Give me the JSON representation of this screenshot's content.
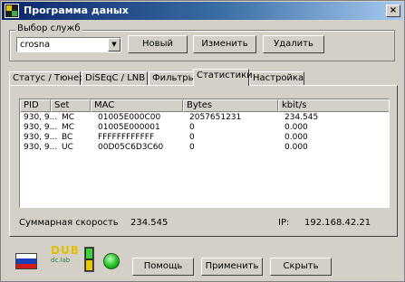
{
  "window": {
    "title": "Программа даных",
    "close_glyph": "×"
  },
  "service": {
    "group_label": "Выбор служб",
    "combo_value": "crosna",
    "buttons": {
      "new": "Новый",
      "edit": "Изменить",
      "delete": "Удалить"
    }
  },
  "tabs": [
    {
      "label": "Статус / Тюнер"
    },
    {
      "label": "DiSEqC / LNB"
    },
    {
      "label": "Фильтры"
    },
    {
      "label": "Статистики",
      "active": true
    },
    {
      "label": "Настройка"
    }
  ],
  "table": {
    "headers": [
      "PID",
      "Set",
      "MAC",
      "Bytes",
      "kbit/s"
    ],
    "rows": [
      [
        "930, 9...",
        "MC",
        "01005E000C00",
        "2057651231",
        "234.545"
      ],
      [
        "930, 9...",
        "MC",
        "01005E000001",
        "0",
        "0.000"
      ],
      [
        "930, 9...",
        "BC",
        "FFFFFFFFFFFF",
        "0",
        "0.000"
      ],
      [
        "930, 9...",
        "UC",
        "00D05C6D3C60",
        "0",
        "0.000"
      ]
    ]
  },
  "status": {
    "speed_label": "Суммарная скорость",
    "speed_value": "234.545",
    "ip_label": "IP:",
    "ip_value": "192.168.42.21"
  },
  "logo": {
    "line1": "DUB",
    "line2": "dc.lab"
  },
  "bottom_buttons": {
    "help": "Помощь",
    "apply": "Применить",
    "hide": "Скрыть"
  },
  "colors": {
    "title_start": "#0a246a",
    "title_end": "#a6caf0",
    "face": "#d4d0c8"
  }
}
